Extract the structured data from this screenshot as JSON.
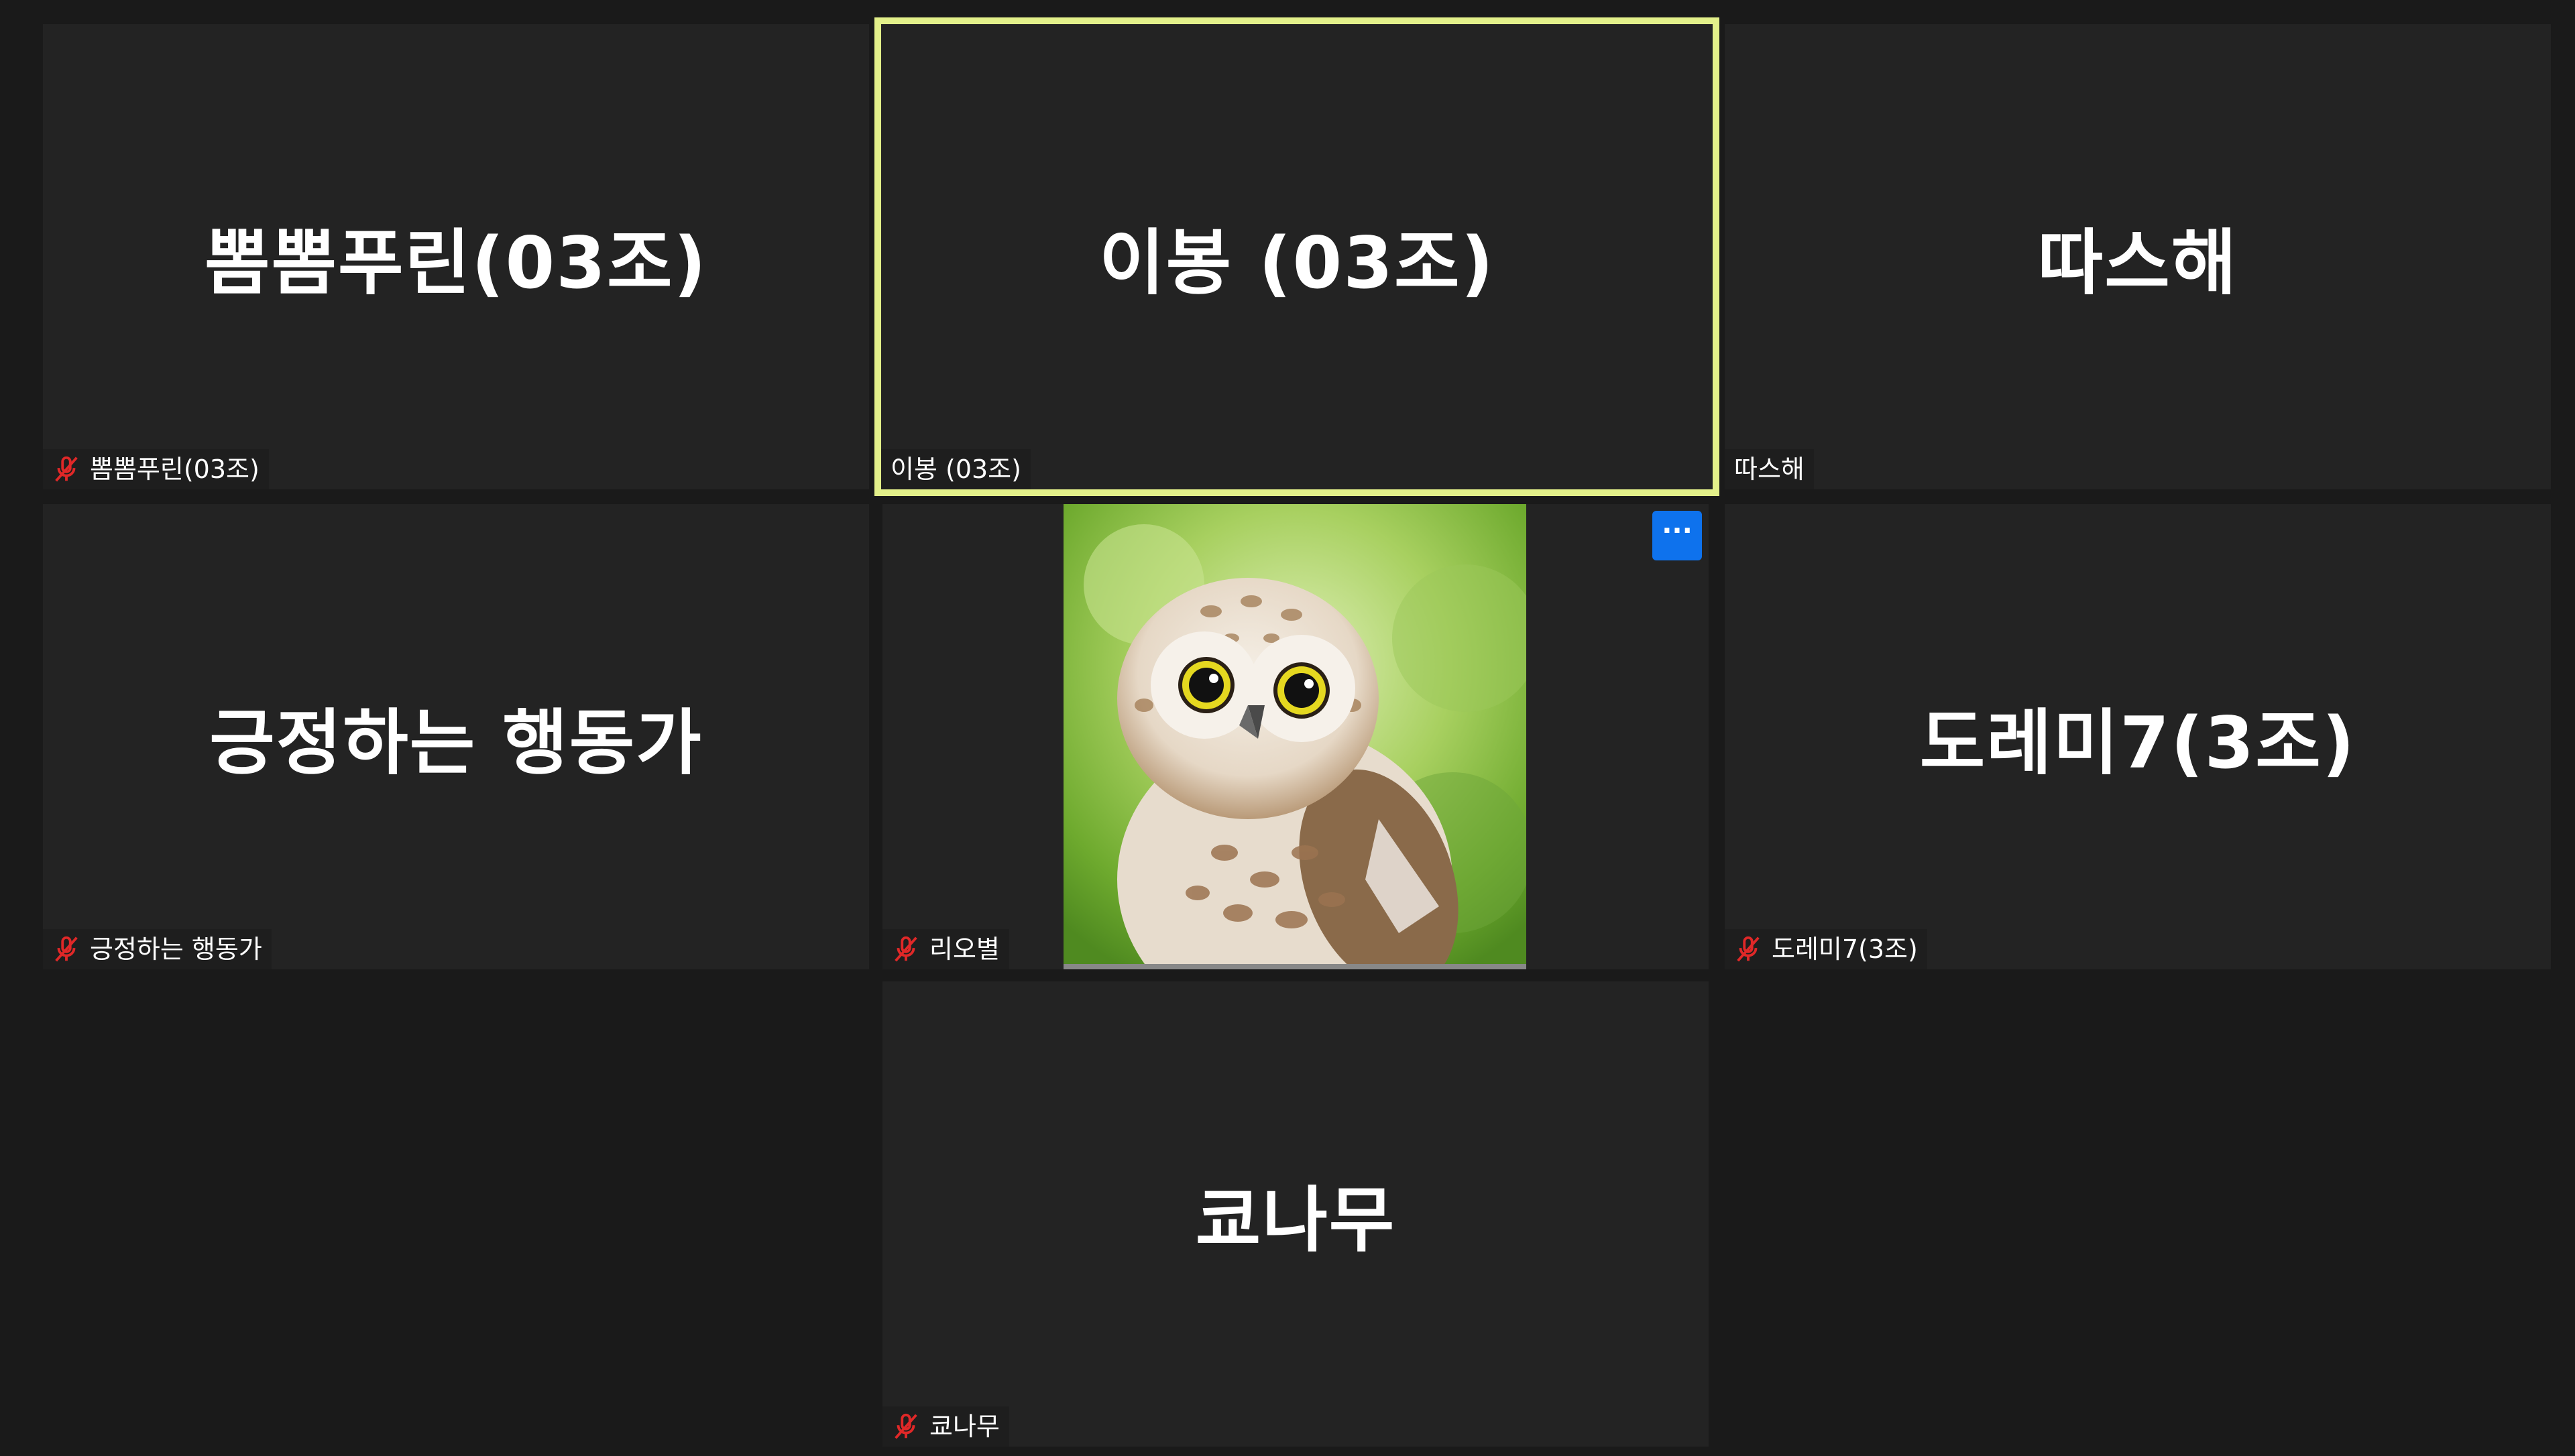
{
  "participants": [
    {
      "display_name": "뽐뽐푸린(03조)",
      "tag_name": "뽐뽐푸린(03조)",
      "muted": true
    },
    {
      "display_name": "이봉 (03조)",
      "tag_name": "이봉 (03조)",
      "muted": false,
      "active_speaker": true
    },
    {
      "display_name": "따스해",
      "tag_name": "따스해",
      "muted": false
    },
    {
      "display_name": "긍정하는 행동가",
      "tag_name": "긍정하는 행동가",
      "muted": true
    },
    {
      "display_name": "",
      "tag_name": "리오별",
      "muted": true,
      "has_video": true,
      "video_subject": "owl"
    },
    {
      "display_name": "도레미7(3조)",
      "tag_name": "도레미7(3조)",
      "muted": true
    },
    {
      "display_name": "쿄나무",
      "tag_name": "쿄나무",
      "muted": true
    }
  ],
  "more_button_label": "···",
  "colors": {
    "active_border": "#e3f08a",
    "active_accent": "#7fd321",
    "tile_bg": "#232323",
    "page_bg": "#1a1a1a",
    "mute_icon": "#e02828",
    "more_button": "#0e72ed"
  },
  "icons": {
    "muted": "microphone-muted-icon",
    "more": "more-options-icon"
  }
}
